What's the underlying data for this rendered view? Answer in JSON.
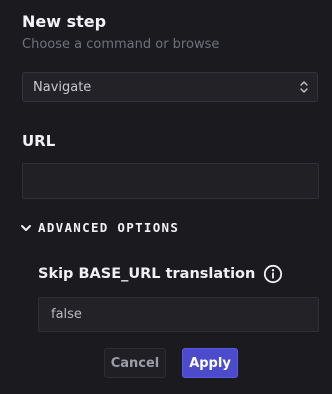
{
  "header": {
    "title": "New step",
    "subtitle": "Choose a command or browse"
  },
  "command_select": {
    "value": "Navigate",
    "icon": "chevron-up-down-icon"
  },
  "url": {
    "label": "URL",
    "value": "",
    "placeholder": ""
  },
  "advanced": {
    "label": "ADVANCED OPTIONS",
    "icon": "chevron-down-icon",
    "expanded": true
  },
  "skip_base_url": {
    "label": "Skip BASE_URL translation",
    "icon": "info-icon",
    "value": "false"
  },
  "actions": {
    "cancel_label": "Cancel",
    "apply_label": "Apply"
  },
  "colors": {
    "background": "#1b1b1f",
    "accent": "#4b4bcc",
    "field_bg": "#222227",
    "muted_text": "#6f717b"
  }
}
